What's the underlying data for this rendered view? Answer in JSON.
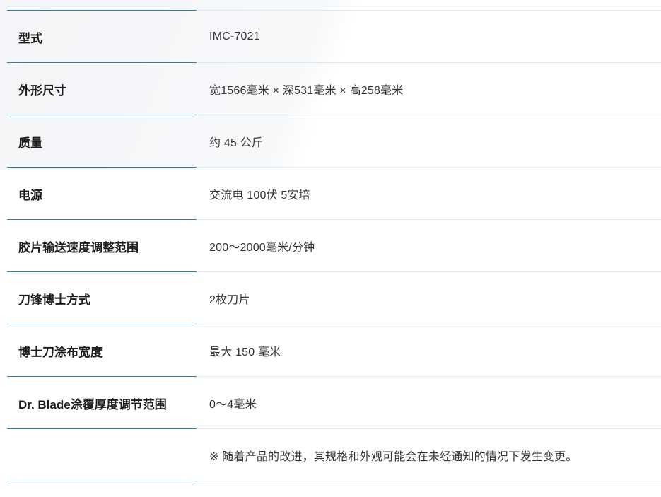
{
  "specs": [
    {
      "label": "型式",
      "value": "IMC-7021"
    },
    {
      "label": "外形尺寸",
      "value": "宽1566毫米 × 深531毫米 × 高258毫米"
    },
    {
      "label": "质量",
      "value": "约 45 公斤"
    },
    {
      "label": "电源",
      "value": "交流电 100伏 5安培"
    },
    {
      "label": "胶片输送速度调整范围",
      "value": "200～2000毫米/分钟"
    },
    {
      "label": "刀锋博士方式",
      "value": "2枚刀片"
    },
    {
      "label": "博士刀涂布宽度",
      "value": "最大 150 毫米"
    },
    {
      "label": "Dr. Blade涂覆厚度调节范围",
      "value": "0～4毫米"
    },
    {
      "label": "",
      "value": "※ 随着产品的改进，其规格和外观可能会在未经通知的情况下发生变更。"
    }
  ],
  "colors": {
    "label_rule": "#2f7fb0",
    "value_rule": "#e3e6ea"
  }
}
